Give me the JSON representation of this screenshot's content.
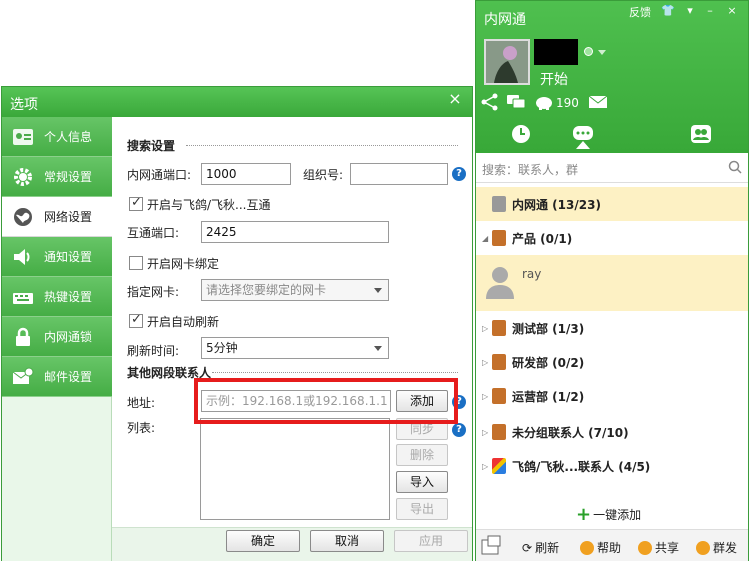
{
  "options_window": {
    "title": "选项",
    "close": "×",
    "sidebar": [
      {
        "label": "个人信息",
        "icon": "id-card-icon"
      },
      {
        "label": "常规设置",
        "icon": "gear-icon"
      },
      {
        "label": "网络设置",
        "icon": "globe-icon"
      },
      {
        "label": "通知设置",
        "icon": "speaker-icon"
      },
      {
        "label": "热键设置",
        "icon": "keyboard-icon"
      },
      {
        "label": "内网通锁",
        "icon": "lock-icon"
      },
      {
        "label": "邮件设置",
        "icon": "mail-gear-icon"
      }
    ],
    "selected_index": 2,
    "search_section": "搜索设置",
    "port_label": "内网通端口:",
    "port_value": "1000",
    "group_label": "组织号:",
    "group_value": "",
    "interop_check": "开启与飞鸽/飞秋...互通",
    "interop_port_label": "互通端口:",
    "interop_port_value": "2425",
    "nic_bind_check": "开启网卡绑定",
    "nic_label": "指定网卡:",
    "nic_placeholder": "请选择您要绑定的网卡",
    "auto_refresh_check": "开启自动刷新",
    "refresh_label": "刷新时间:",
    "refresh_value": "5分钟",
    "other_section": "其他网段联系人",
    "address_label": "地址:",
    "address_placeholder": "示例：192.168.1或192.168.1.1",
    "add_button": "添加",
    "list_label": "列表:",
    "sync_button": "同步",
    "delete_button": "删除",
    "import_button": "导入",
    "export_button": "导出",
    "ok_button": "确定",
    "cancel_button": "取消",
    "apply_button": "应用"
  },
  "im_panel": {
    "title": "内网通",
    "feedback": "反馈",
    "signature": "开始",
    "count": "190",
    "search_placeholder": "搜索：联系人，群",
    "groups": [
      {
        "label": "内网通 (13/23)",
        "expanded": false
      },
      {
        "label": "产品 (0/1)",
        "expanded": true
      },
      {
        "label": "测试部 (1/3)",
        "expanded": false
      },
      {
        "label": "研发部 (0/2)",
        "expanded": false
      },
      {
        "label": "运营部 (1/2)",
        "expanded": false
      },
      {
        "label": "未分组联系人 (7/10)",
        "expanded": false
      },
      {
        "label": "飞鸽/飞秋...联系人 (4/5)",
        "expanded": false
      }
    ],
    "contact": "ray",
    "one_click_add": "一键添加",
    "bottom": {
      "refresh": "刷新",
      "help": "帮助",
      "share": "共享",
      "broadcast": "群发"
    }
  }
}
